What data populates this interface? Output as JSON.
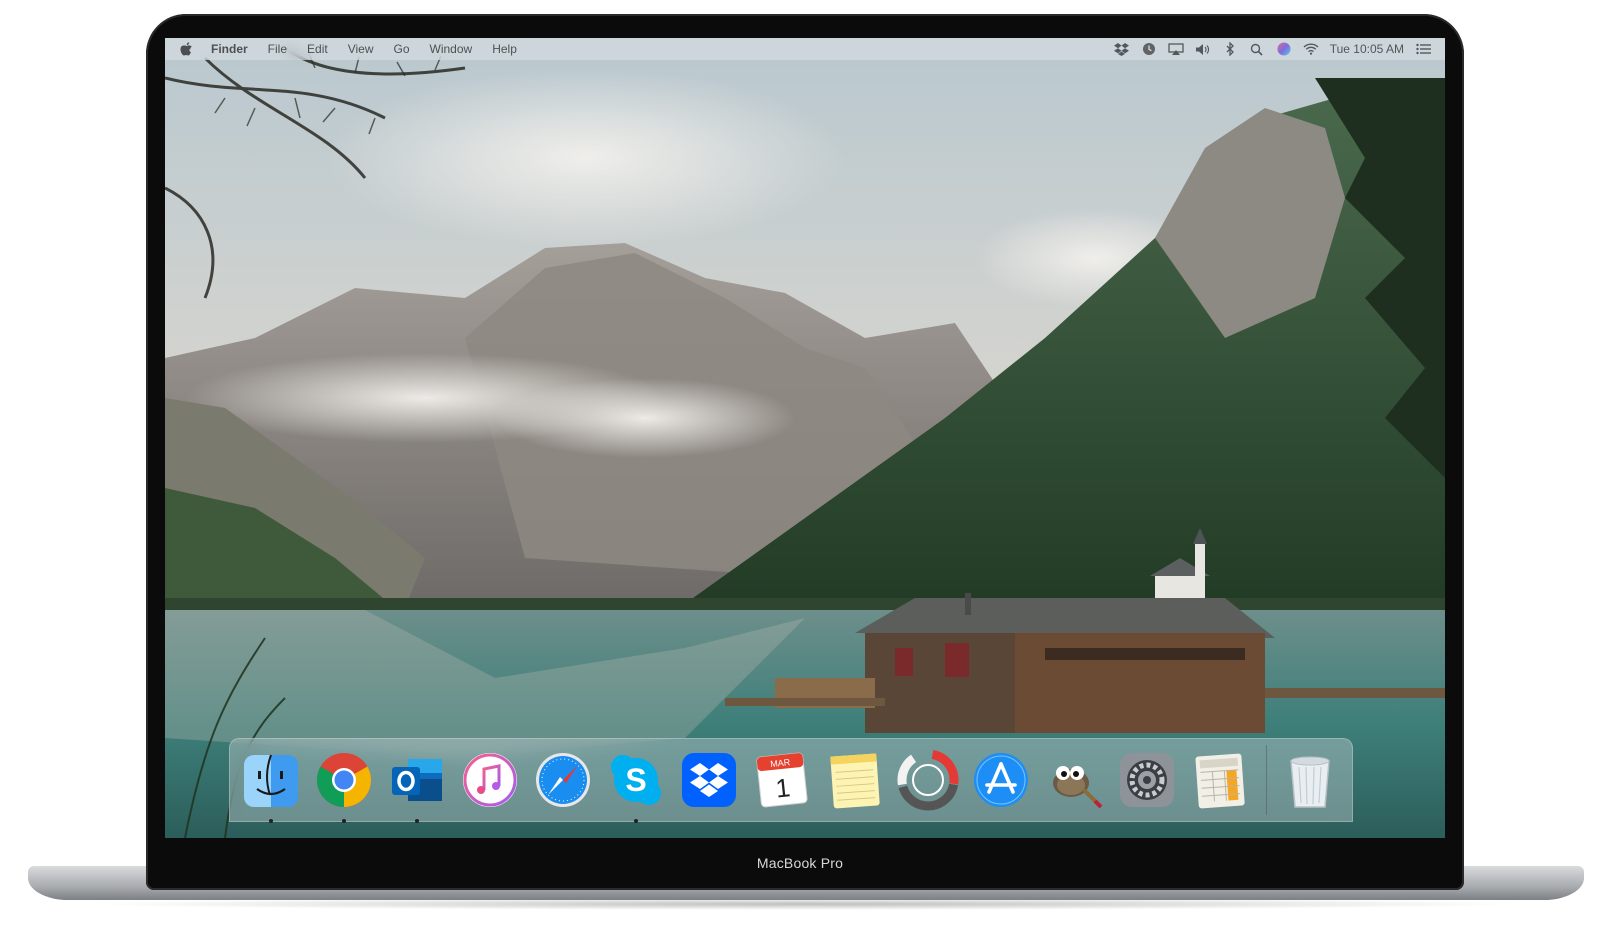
{
  "menubar": {
    "apple_icon": "apple-logo-icon",
    "items": [
      "Finder",
      "File",
      "Edit",
      "View",
      "Go",
      "Window",
      "Help"
    ],
    "status_icons": [
      "dropbox-icon",
      "timemachine-icon",
      "airplay-icon",
      "volume-icon",
      "bluetooth-icon",
      "spotlight-search-icon",
      "siri-icon",
      "wifi-icon"
    ],
    "clock": "Tue 10:05 AM",
    "notification_icon": "notification-center-icon"
  },
  "dock": {
    "apps": [
      {
        "name": "finder",
        "running": true
      },
      {
        "name": "chrome",
        "running": true
      },
      {
        "name": "outlook",
        "running": true
      },
      {
        "name": "itunes",
        "running": false
      },
      {
        "name": "safari",
        "running": false
      },
      {
        "name": "skype",
        "running": true
      },
      {
        "name": "dropbox",
        "running": false
      },
      {
        "name": "calendar",
        "running": false,
        "month": "MAR",
        "day": "1"
      },
      {
        "name": "notes",
        "running": false
      },
      {
        "name": "daisydisk",
        "running": false
      },
      {
        "name": "app-store",
        "running": false
      },
      {
        "name": "gimp",
        "running": false
      },
      {
        "name": "system-preferences",
        "running": false
      },
      {
        "name": "numbers",
        "running": false
      }
    ],
    "trash": {
      "name": "trash",
      "running": false
    }
  },
  "device": {
    "model_label": "MacBook Pro"
  },
  "colors": {
    "menubar_bg": "#dce1e6",
    "bezel": "#0b0b0c",
    "lake": "#3e7f7a",
    "forest": "#2e4a2f"
  }
}
